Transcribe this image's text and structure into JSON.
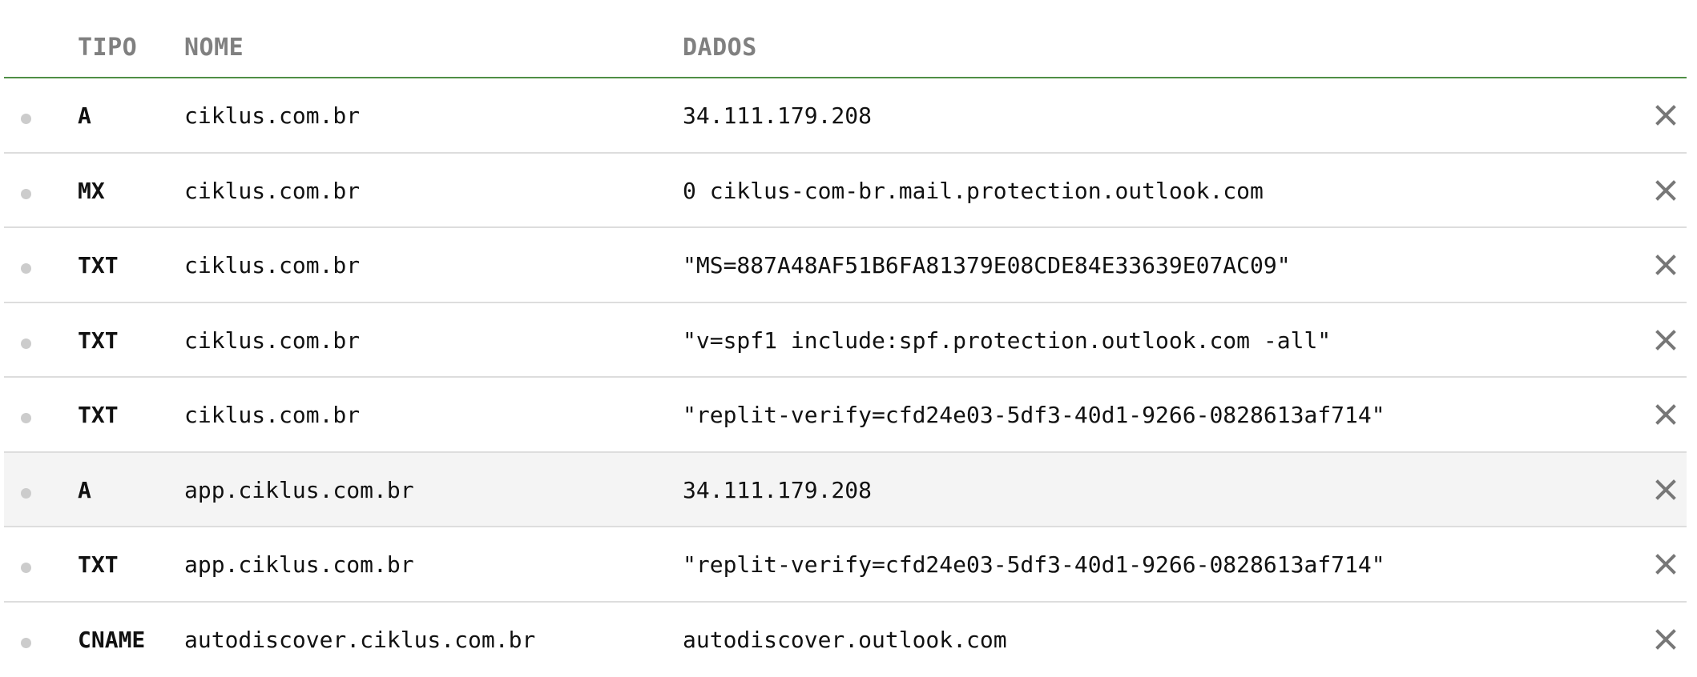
{
  "header": {
    "type": "TIPO",
    "name": "NOME",
    "data": "DADOS"
  },
  "records": [
    {
      "type": "A",
      "name": "ciklus.com.br",
      "data": "34.111.179.208"
    },
    {
      "type": "MX",
      "name": "ciklus.com.br",
      "data": "0 ciklus-com-br.mail.protection.outlook.com"
    },
    {
      "type": "TXT",
      "name": "ciklus.com.br",
      "data": "\"MS=887A48AF51B6FA81379E08CDE84E33639E07AC09\""
    },
    {
      "type": "TXT",
      "name": "ciklus.com.br",
      "data": "\"v=spf1 include:spf.protection.outlook.com -all\""
    },
    {
      "type": "TXT",
      "name": "ciklus.com.br",
      "data": "\"replit-verify=cfd24e03-5df3-40d1-9266-0828613af714\""
    },
    {
      "type": "A",
      "name": "app.ciklus.com.br",
      "data": "34.111.179.208"
    },
    {
      "type": "TXT",
      "name": "app.ciklus.com.br",
      "data": "\"replit-verify=cfd24e03-5df3-40d1-9266-0828613af714\""
    },
    {
      "type": "CNAME",
      "name": "autodiscover.ciklus.com.br",
      "data": "autodiscover.outlook.com"
    }
  ],
  "icons": {
    "status": "status-dot-icon",
    "delete": "close-icon"
  },
  "colors": {
    "header_border": "#4f8f45",
    "header_text": "#808080",
    "row_border": "#dddddd",
    "highlight_row": "#f4f4f4",
    "status_dot": "#cccccc",
    "delete_icon": "#777777"
  }
}
